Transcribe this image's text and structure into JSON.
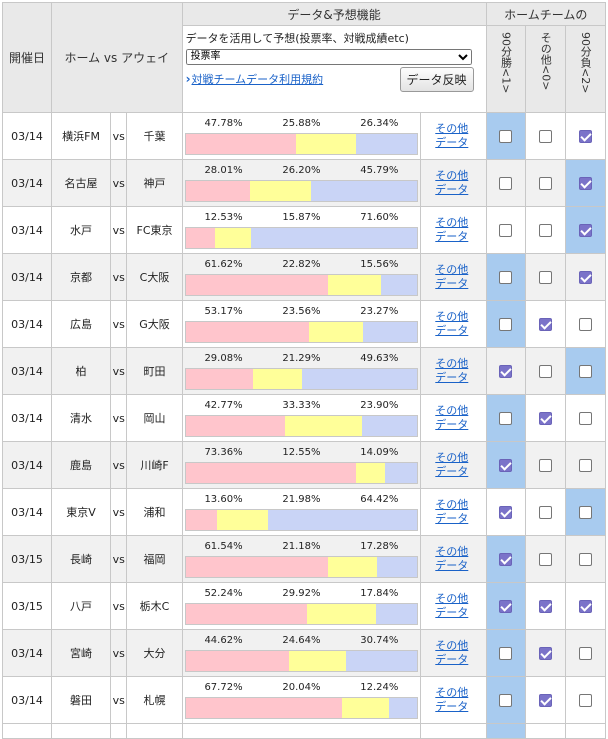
{
  "header": {
    "date": "開催日",
    "match": "ホーム vs アウェイ",
    "data_title": "データ&予想機能",
    "data_desc": "データを活用して予想(投票率、対戦成績etc)",
    "select_value": "投票率",
    "terms_link": "対戦チームデータ利用規約",
    "reflect_button": "データ反映",
    "home_team_title": "ホームチームの",
    "col_win": "90分勝<1>",
    "col_other": "その他<0>",
    "col_lose": "90分負<2>"
  },
  "vs_label": "vs",
  "other_data_line1": "その他",
  "other_data_line2": "データ",
  "colors": {
    "home": "#ffc5cc",
    "draw": "#ffff99",
    "away": "#c9d4f6",
    "highlight": "#a8cbef",
    "check": "#7b73c9"
  },
  "matches": [
    {
      "date": "03/14",
      "home": "横浜FM",
      "away": "千葉",
      "p1": "47.78%",
      "p0": "25.88%",
      "p2": "26.34%",
      "v1": 47.78,
      "v0": 25.88,
      "v2": 26.34,
      "win": false,
      "other": false,
      "lose": true,
      "hl": [
        true,
        false,
        false
      ]
    },
    {
      "date": "03/14",
      "home": "名古屋",
      "away": "神戸",
      "p1": "28.01%",
      "p0": "26.20%",
      "p2": "45.79%",
      "v1": 28.01,
      "v0": 26.2,
      "v2": 45.79,
      "win": false,
      "other": false,
      "lose": true,
      "hl": [
        false,
        false,
        true
      ]
    },
    {
      "date": "03/14",
      "home": "水戸",
      "away": "FC東京",
      "p1": "12.53%",
      "p0": "15.87%",
      "p2": "71.60%",
      "v1": 12.53,
      "v0": 15.87,
      "v2": 71.6,
      "win": false,
      "other": false,
      "lose": true,
      "hl": [
        false,
        false,
        true
      ]
    },
    {
      "date": "03/14",
      "home": "京都",
      "away": "C大阪",
      "p1": "61.62%",
      "p0": "22.82%",
      "p2": "15.56%",
      "v1": 61.62,
      "v0": 22.82,
      "v2": 15.56,
      "win": false,
      "other": false,
      "lose": true,
      "hl": [
        true,
        false,
        false
      ]
    },
    {
      "date": "03/14",
      "home": "広島",
      "away": "G大阪",
      "p1": "53.17%",
      "p0": "23.56%",
      "p2": "23.27%",
      "v1": 53.17,
      "v0": 23.56,
      "v2": 23.27,
      "win": false,
      "other": true,
      "lose": false,
      "hl": [
        true,
        false,
        false
      ]
    },
    {
      "date": "03/14",
      "home": "柏",
      "away": "町田",
      "p1": "29.08%",
      "p0": "21.29%",
      "p2": "49.63%",
      "v1": 29.08,
      "v0": 21.29,
      "v2": 49.63,
      "win": true,
      "other": false,
      "lose": false,
      "hl": [
        false,
        false,
        true
      ]
    },
    {
      "date": "03/14",
      "home": "清水",
      "away": "岡山",
      "p1": "42.77%",
      "p0": "33.33%",
      "p2": "23.90%",
      "v1": 42.77,
      "v0": 33.33,
      "v2": 23.9,
      "win": false,
      "other": true,
      "lose": false,
      "hl": [
        true,
        false,
        false
      ]
    },
    {
      "date": "03/14",
      "home": "鹿島",
      "away": "川崎F",
      "p1": "73.36%",
      "p0": "12.55%",
      "p2": "14.09%",
      "v1": 73.36,
      "v0": 12.55,
      "v2": 14.09,
      "win": true,
      "other": false,
      "lose": false,
      "hl": [
        true,
        false,
        false
      ]
    },
    {
      "date": "03/14",
      "home": "東京V",
      "away": "浦和",
      "p1": "13.60%",
      "p0": "21.98%",
      "p2": "64.42%",
      "v1": 13.6,
      "v0": 21.98,
      "v2": 64.42,
      "win": true,
      "other": false,
      "lose": false,
      "hl": [
        false,
        false,
        true
      ]
    },
    {
      "date": "03/15",
      "home": "長崎",
      "away": "福岡",
      "p1": "61.54%",
      "p0": "21.18%",
      "p2": "17.28%",
      "v1": 61.54,
      "v0": 21.18,
      "v2": 17.28,
      "win": true,
      "other": false,
      "lose": false,
      "hl": [
        true,
        false,
        false
      ]
    },
    {
      "date": "03/15",
      "home": "八戸",
      "away": "栃木C",
      "p1": "52.24%",
      "p0": "29.92%",
      "p2": "17.84%",
      "v1": 52.24,
      "v0": 29.92,
      "v2": 17.84,
      "win": true,
      "other": true,
      "lose": true,
      "hl": [
        true,
        false,
        false
      ]
    },
    {
      "date": "03/14",
      "home": "宮崎",
      "away": "大分",
      "p1": "44.62%",
      "p0": "24.64%",
      "p2": "30.74%",
      "v1": 44.62,
      "v0": 24.64,
      "v2": 30.74,
      "win": false,
      "other": true,
      "lose": false,
      "hl": [
        true,
        false,
        false
      ]
    },
    {
      "date": "03/14",
      "home": "磐田",
      "away": "札幌",
      "p1": "67.72%",
      "p0": "20.04%",
      "p2": "12.24%",
      "v1": 67.72,
      "v0": 20.04,
      "v2": 12.24,
      "win": false,
      "other": true,
      "lose": false,
      "hl": [
        true,
        false,
        false
      ]
    }
  ]
}
